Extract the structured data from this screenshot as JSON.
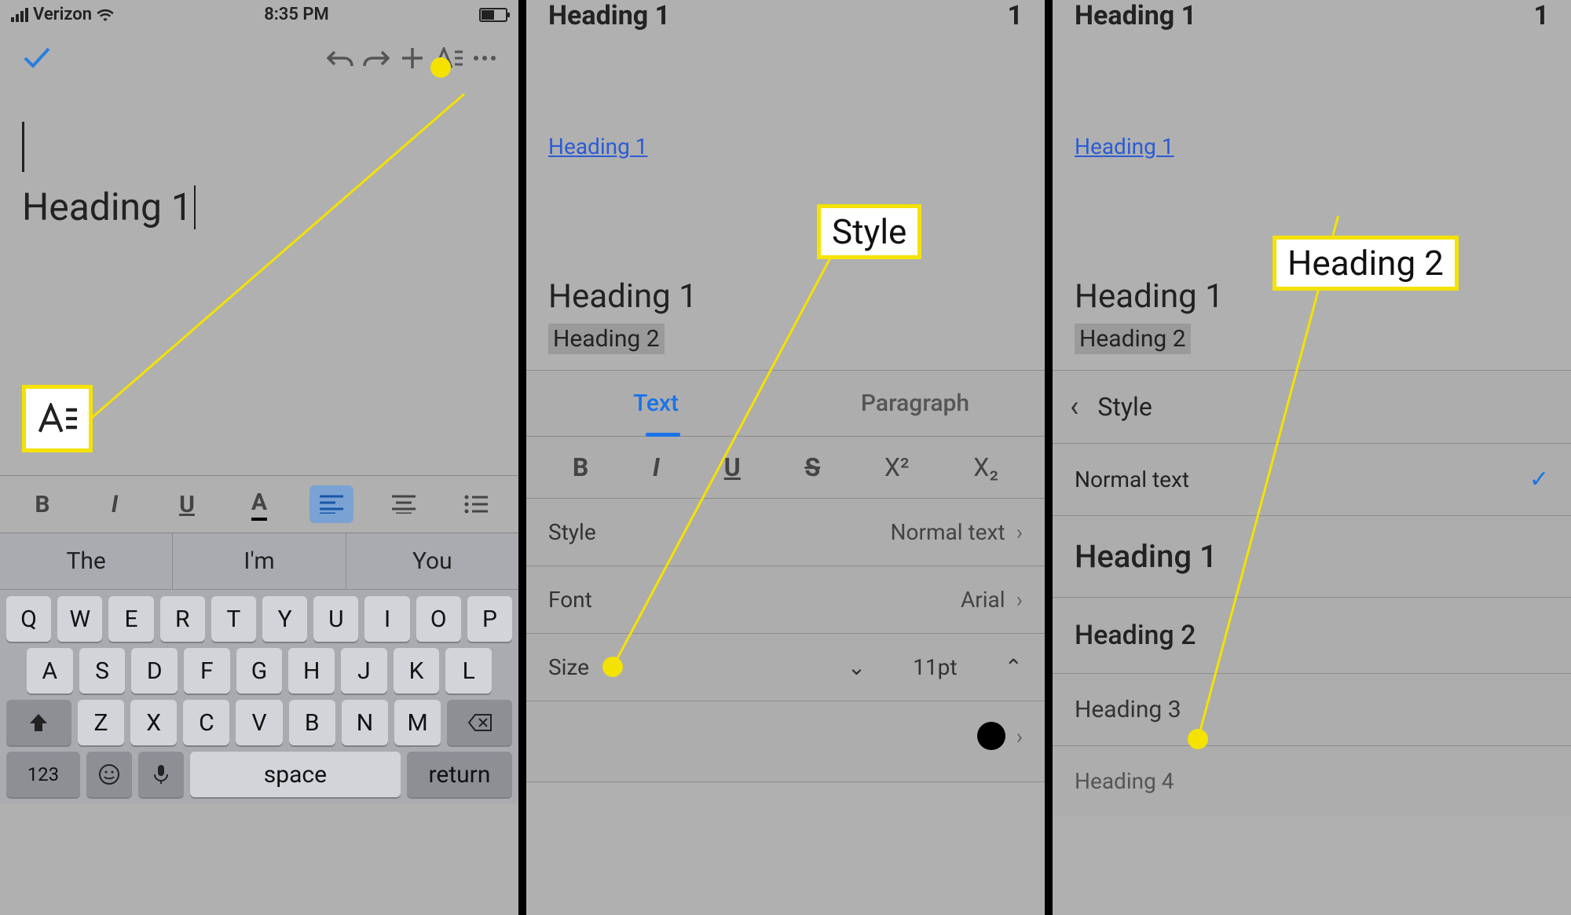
{
  "panel1": {
    "status": {
      "carrier": "Verizon",
      "time": "8:35 PM"
    },
    "doc": {
      "heading1": "Heading 1"
    },
    "predictive": [
      "The",
      "I'm",
      "You"
    ],
    "keyboard": {
      "row1": [
        "Q",
        "W",
        "E",
        "R",
        "T",
        "Y",
        "U",
        "I",
        "O",
        "P"
      ],
      "row2": [
        "A",
        "S",
        "D",
        "F",
        "G",
        "H",
        "J",
        "K",
        "L"
      ],
      "row3": [
        "Z",
        "X",
        "C",
        "V",
        "B",
        "N",
        "M"
      ],
      "num": "123",
      "space": "space",
      "return": "return"
    }
  },
  "panel2": {
    "header": {
      "title": "Heading 1",
      "count": "1"
    },
    "toc_link": "Heading 1",
    "preview": {
      "h1": "Heading 1",
      "h2": "Heading 2"
    },
    "tabs": {
      "text": "Text",
      "paragraph": "Paragraph"
    },
    "format": {
      "bold": "B",
      "italic": "I",
      "underline": "U",
      "strike": "S",
      "sup": "X²",
      "sub": "X₂"
    },
    "rows": {
      "style_label": "Style",
      "style_value": "Normal text",
      "font_label": "Font",
      "font_value": "Arial",
      "size_label": "Size",
      "size_value": "11pt"
    },
    "callout": "Style"
  },
  "panel3": {
    "header": {
      "title": "Heading 1",
      "count": "1"
    },
    "toc_link": "Heading 1",
    "preview": {
      "h1": "Heading 1",
      "h2": "Heading 2"
    },
    "style_header": "Style",
    "styles": {
      "normal": "Normal text",
      "h1": "Heading 1",
      "h2": "Heading 2",
      "h3": "Heading 3",
      "h4": "Heading 4"
    },
    "callout": "Heading 2"
  }
}
